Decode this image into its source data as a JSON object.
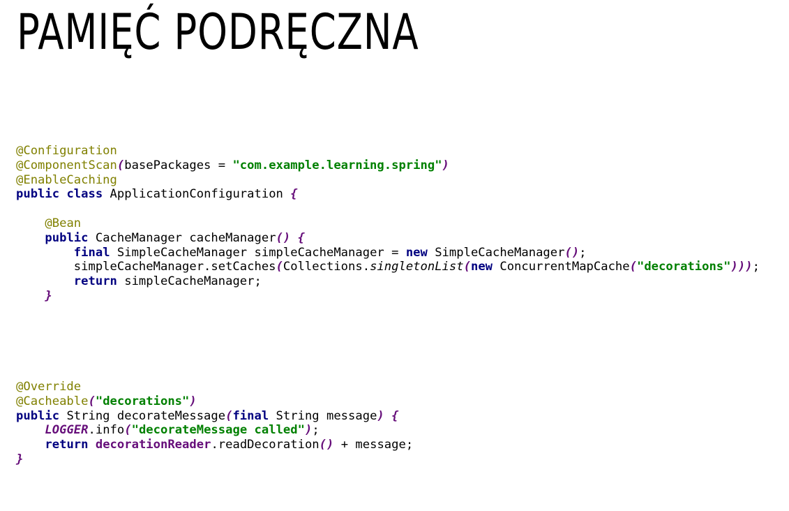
{
  "slide": {
    "title": "PAMIĘĆ PODRĘCZNA"
  },
  "colors": {
    "annotation": "#808000",
    "keyword": "#000080",
    "string": "#008000",
    "bracket": "#660e7a",
    "text": "#000000",
    "background": "#ffffff"
  },
  "code_blocks": [
    {
      "id": "code-config",
      "lines": [
        [
          {
            "t": "@Configuration",
            "k": "annotation"
          }
        ],
        [
          {
            "t": "@ComponentScan",
            "k": "annotation"
          },
          {
            "t": "(",
            "k": "paren"
          },
          {
            "t": "basePackages = ",
            "k": "plain"
          },
          {
            "t": "\"com.example.learning.spring\"",
            "k": "string"
          },
          {
            "t": ")",
            "k": "paren"
          }
        ],
        [
          {
            "t": "@EnableCaching",
            "k": "annotation"
          }
        ],
        [
          {
            "t": "public",
            "k": "keyword"
          },
          {
            "t": " ",
            "k": "plain"
          },
          {
            "t": "class",
            "k": "keyword"
          },
          {
            "t": " ApplicationConfiguration ",
            "k": "plain"
          },
          {
            "t": "{",
            "k": "paren"
          }
        ],
        [],
        [
          {
            "t": "    ",
            "k": "plain"
          },
          {
            "t": "@Bean",
            "k": "annotation"
          }
        ],
        [
          {
            "t": "    ",
            "k": "plain"
          },
          {
            "t": "public",
            "k": "keyword"
          },
          {
            "t": " CacheManager cacheManager",
            "k": "plain"
          },
          {
            "t": "()",
            "k": "paren"
          },
          {
            "t": " ",
            "k": "plain"
          },
          {
            "t": "{",
            "k": "paren"
          }
        ],
        [
          {
            "t": "        ",
            "k": "plain"
          },
          {
            "t": "final",
            "k": "keyword"
          },
          {
            "t": " SimpleCacheManager simpleCacheManager = ",
            "k": "plain"
          },
          {
            "t": "new",
            "k": "keyword"
          },
          {
            "t": " SimpleCacheManager",
            "k": "plain"
          },
          {
            "t": "()",
            "k": "paren"
          },
          {
            "t": ";",
            "k": "plain"
          }
        ],
        [
          {
            "t": "        simpleCacheManager.setCaches",
            "k": "plain"
          },
          {
            "t": "(",
            "k": "paren"
          },
          {
            "t": "Collections.",
            "k": "plain"
          },
          {
            "t": "singletonList",
            "k": "method-static"
          },
          {
            "t": "(",
            "k": "paren"
          },
          {
            "t": "new",
            "k": "keyword"
          },
          {
            "t": " ConcurrentMapCache",
            "k": "plain"
          },
          {
            "t": "(",
            "k": "paren"
          },
          {
            "t": "\"decorations\"",
            "k": "string"
          },
          {
            "t": ")))",
            "k": "paren"
          },
          {
            "t": ";",
            "k": "plain"
          }
        ],
        [
          {
            "t": "        ",
            "k": "plain"
          },
          {
            "t": "return",
            "k": "keyword"
          },
          {
            "t": " simpleCacheManager;",
            "k": "plain"
          }
        ],
        [
          {
            "t": "    ",
            "k": "plain"
          },
          {
            "t": "}",
            "k": "paren"
          }
        ]
      ]
    },
    {
      "id": "code-method",
      "lines": [
        [
          {
            "t": "@Override",
            "k": "annotation"
          }
        ],
        [
          {
            "t": "@Cacheable",
            "k": "annotation"
          },
          {
            "t": "(",
            "k": "paren"
          },
          {
            "t": "\"decorations\"",
            "k": "string"
          },
          {
            "t": ")",
            "k": "paren"
          }
        ],
        [
          {
            "t": "public",
            "k": "keyword"
          },
          {
            "t": " String decorateMessage",
            "k": "plain"
          },
          {
            "t": "(",
            "k": "paren"
          },
          {
            "t": "final",
            "k": "keyword"
          },
          {
            "t": " String message",
            "k": "plain"
          },
          {
            "t": ")",
            "k": "paren"
          },
          {
            "t": " ",
            "k": "plain"
          },
          {
            "t": "{",
            "k": "paren"
          }
        ],
        [
          {
            "t": "    ",
            "k": "plain"
          },
          {
            "t": "LOGGER",
            "k": "static"
          },
          {
            "t": ".info",
            "k": "plain"
          },
          {
            "t": "(",
            "k": "paren"
          },
          {
            "t": "\"decorateMessage called\"",
            "k": "string"
          },
          {
            "t": ")",
            "k": "paren"
          },
          {
            "t": ";",
            "k": "plain"
          }
        ],
        [
          {
            "t": "    ",
            "k": "plain"
          },
          {
            "t": "return",
            "k": "keyword"
          },
          {
            "t": " ",
            "k": "plain"
          },
          {
            "t": "decorationReader",
            "k": "field"
          },
          {
            "t": ".readDecoration",
            "k": "plain"
          },
          {
            "t": "()",
            "k": "paren"
          },
          {
            "t": " + message;",
            "k": "plain"
          }
        ],
        [
          {
            "t": "}",
            "k": "paren"
          }
        ]
      ]
    }
  ]
}
